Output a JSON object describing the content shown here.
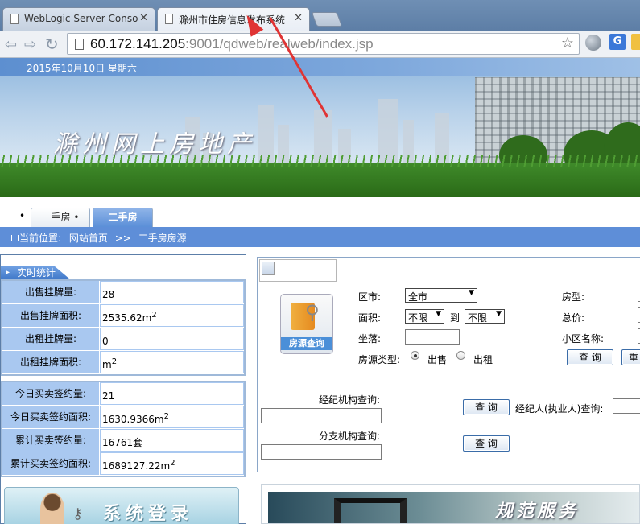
{
  "browser": {
    "tabs": [
      {
        "title": "WebLogic Server Conso",
        "active": false
      },
      {
        "title": "滁州市住房信息发布系统",
        "active": true
      }
    ],
    "url_host": "60.172.141.205",
    "url_rest": ":9001/qdweb/realweb/index.jsp",
    "annotation_color": "#e03434"
  },
  "header": {
    "date": "2015年10月10日  星期六",
    "site_title": "滁州网上房地产"
  },
  "nav": {
    "bullet": "•",
    "tabs": [
      "一手房  •",
      "二手房"
    ],
    "active_tab": "二手房"
  },
  "breadcrumb": {
    "prefix": "当前位置:",
    "home": "网站首页",
    "separator": ">>",
    "current": "二手房房源"
  },
  "stats": {
    "header": "实时统计",
    "group1": [
      {
        "label": "出售挂牌量:",
        "value": "28",
        "sup": ""
      },
      {
        "label": "出售挂牌面积:",
        "value": "2535.62m",
        "sup": "2"
      },
      {
        "label": "出租挂牌量:",
        "value": "0",
        "sup": ""
      },
      {
        "label": "出租挂牌面积:",
        "value": "m",
        "sup": "2"
      }
    ],
    "group2": [
      {
        "label": "今日买卖签约量:",
        "value": "21",
        "sup": ""
      },
      {
        "label": "今日买卖签约面积:",
        "value": "1630.9366m",
        "sup": "2"
      },
      {
        "label": "累计买卖签约量:",
        "value": "16761套",
        "sup": ""
      },
      {
        "label": "累计买卖签约面积:",
        "value": "1689127.22m",
        "sup": "2"
      }
    ]
  },
  "login": {
    "title": "系统登录"
  },
  "search": {
    "icon_caption": "房源查询",
    "district_label": "区市:",
    "district_value": "全市",
    "area_label": "面积:",
    "area_from": "不限",
    "area_to_label": "到",
    "area_to": "不限",
    "location_label": "坐落:",
    "type_label": "房源类型:",
    "type_options": [
      "出售",
      "出租"
    ],
    "type_selected": "出售",
    "room_label": "房型:",
    "price_label": "总价:",
    "community_label": "小区名称:",
    "query_button": "查 询",
    "reset_button": "重",
    "agency_label": "经纪机构查询:",
    "agency_button": "查 询",
    "agent_label": "经纪人(执业人)查询:",
    "branch_label": "分支机构查询:",
    "branch_button": "查 询"
  },
  "promo": {
    "text": "规范服务"
  }
}
